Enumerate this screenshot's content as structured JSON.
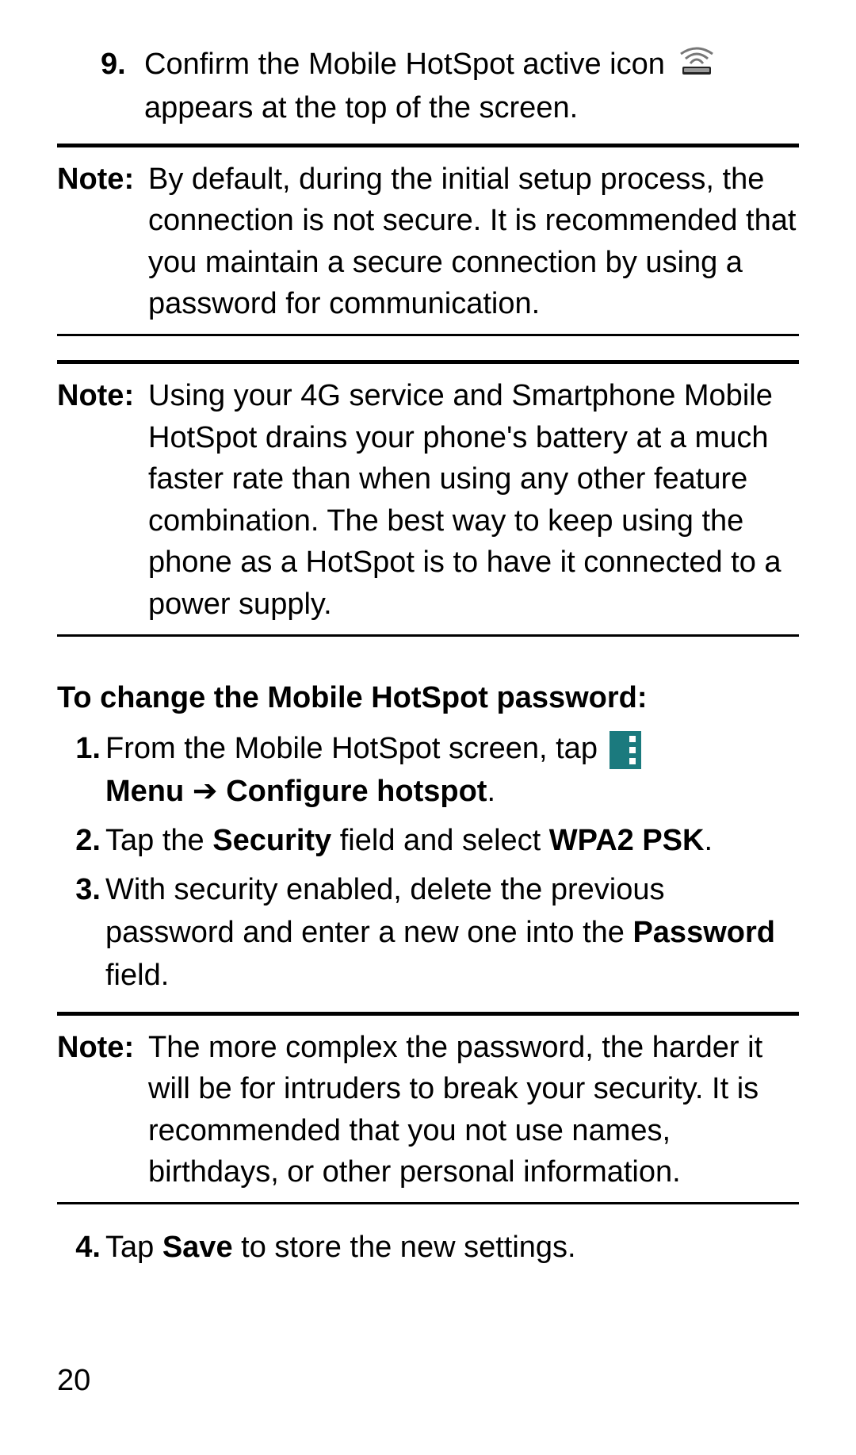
{
  "step9": {
    "number": "9.",
    "text_before_icon": "Confirm the Mobile HotSpot active icon",
    "text_after_icon": "appears at the top of the screen."
  },
  "notes": {
    "note1_label": "Note:",
    "note1_body": "By default, during the initial setup process, the connection is not secure. It is recommended that you maintain a secure connection by using a password for communication.",
    "note2_label": "Note:",
    "note2_body": "Using your 4G service and Smartphone Mobile HotSpot drains your phone's battery at a much faster rate than when using any other feature combination. The best way to keep using the phone as a HotSpot is to have it connected to a power supply.",
    "note3_label": "Note:",
    "note3_body": "The more complex the password, the harder it will be for intruders to break your security. It is recommended that you not use names, birthdays, or other personal information."
  },
  "heading": "To change the Mobile HotSpot password:",
  "steps": {
    "s1_num": "1.",
    "s1_a": "From the Mobile HotSpot screen, tap",
    "s1_menu": "Menu",
    "s1_arrow": "➔",
    "s1_configure": "Configure hotspot",
    "s1_period": ".",
    "s2_num": "2.",
    "s2_a": "Tap the ",
    "s2_security": "Security",
    "s2_b": " field and select ",
    "s2_wpa": "WPA2 PSK",
    "s2_period": ".",
    "s3_num": "3.",
    "s3_a": "With security enabled, delete the previous password and enter a new one into the ",
    "s3_password": "Password",
    "s3_b": " field.",
    "s4_num": "4.",
    "s4_a": "Tap ",
    "s4_save": "Save",
    "s4_b": " to store the new settings."
  },
  "page_number": "20"
}
